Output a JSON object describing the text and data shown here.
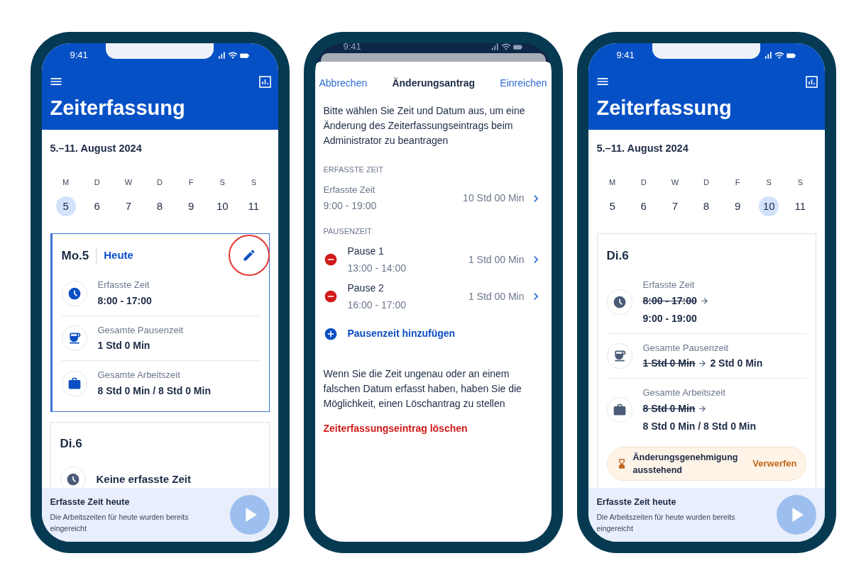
{
  "phones": [
    {
      "kind": "timesheet",
      "status_time": "9:41",
      "title": "Zeiterfassung",
      "week_range": "5.–11. August 2024",
      "weekdays": [
        {
          "letter": "M",
          "day": "5",
          "selected": true
        },
        {
          "letter": "D",
          "day": "6",
          "selected": false
        },
        {
          "letter": "W",
          "day": "7",
          "selected": false
        },
        {
          "letter": "D",
          "day": "8",
          "selected": false
        },
        {
          "letter": "F",
          "day": "9",
          "selected": false
        },
        {
          "letter": "S",
          "day": "10",
          "selected": false
        },
        {
          "letter": "S",
          "day": "11",
          "selected": false
        }
      ],
      "cards": [
        {
          "day_label": "Mo.5",
          "badge": "Heute",
          "highlighted": true,
          "editable": true,
          "edit_marked": true,
          "rows": [
            {
              "kind": "clock",
              "label": "Erfasste Zeit",
              "value": "8:00 - 17:00"
            },
            {
              "kind": "cup",
              "label": "Gesamte Pausenzeit",
              "value": "1 Std 0 Min"
            },
            {
              "kind": "briefcase",
              "label": "Gesamte Arbeitszeit",
              "value": "8 Std 0 Min / 8 Std 0 Min"
            }
          ]
        },
        {
          "day_label": "Di.6",
          "highlighted": false,
          "editable": false,
          "rows": [
            {
              "kind": "clock",
              "value": "Keine erfasste Zeit"
            }
          ]
        }
      ],
      "footer": {
        "title": "Erfasste Zeit heute",
        "text": "Die Arbeitszeiten für heute wurden bereits eingereicht",
        "play_disabled": true
      }
    },
    {
      "kind": "change_request",
      "status_time": "9:41",
      "cancel": "Abbrechen",
      "title": "Änderungsantrag",
      "submit": "Einreichen",
      "intro": "Bitte wählen Sie Zeit und Datum aus, um eine Änderung des Zeiterfassungseintrags beim Administrator zu beantragen",
      "sections": [
        {
          "heading": "ERFASSTE ZEIT",
          "items": [
            {
              "kind": "time",
              "label": "Erfasste Zeit",
              "range": "9:00 - 19:00",
              "duration": "10 Std 00 Min"
            }
          ]
        },
        {
          "heading": "PAUSENZEIT",
          "items": [
            {
              "kind": "pause",
              "label": "Pause 1",
              "range": "13:00 - 14:00",
              "duration": "1 Std 00 Min"
            },
            {
              "kind": "pause",
              "label": "Pause 2",
              "range": "16:00 - 17:00",
              "duration": "1 Std 00 Min"
            }
          ]
        }
      ],
      "add_label": "Pausenzeit hinzufügen",
      "delete_info": "Wenn Sie die Zeit ungenau oder an einem falschen Datum erfasst haben, haben Sie die Möglichkeit, einen Löschantrag zu stellen",
      "delete_label": "Zeiterfassungseintrag löschen"
    },
    {
      "kind": "timesheet",
      "status_time": "9:41",
      "title": "Zeiterfassung",
      "week_range": "5.–11. August 2024",
      "weekdays": [
        {
          "letter": "M",
          "day": "5",
          "selected": false
        },
        {
          "letter": "D",
          "day": "6",
          "selected": false
        },
        {
          "letter": "W",
          "day": "7",
          "selected": false
        },
        {
          "letter": "D",
          "day": "8",
          "selected": false
        },
        {
          "letter": "F",
          "day": "9",
          "selected": false
        },
        {
          "letter": "S",
          "day": "10",
          "selected": true
        },
        {
          "letter": "S",
          "day": "11",
          "selected": false
        }
      ],
      "cards": [
        {
          "day_label": "Di.6",
          "highlighted": false,
          "editable": false,
          "rows": [
            {
              "kind": "clock",
              "label": "Erfasste Zeit",
              "old_value": "8:00 - 17:00",
              "same_line": false,
              "value": "9:00 - 19:00"
            },
            {
              "kind": "cup",
              "label": "Gesamte Pausenzeit",
              "old_value": "1 Std 0 Min",
              "same_line": true,
              "value": "2 Std 0 Min"
            },
            {
              "kind": "briefcase",
              "label": "Gesamte Arbeitszeit",
              "old_value": "8 Std 0 Min",
              "same_line": false,
              "value": "8 Std 0 Min / 8 Std 0 Min"
            }
          ],
          "pending": {
            "text": "Änderungsgenehmigung ausstehend",
            "action": "Verwerfen"
          }
        }
      ],
      "footer": {
        "title": "Erfasste Zeit heute",
        "text": "Die Arbeitszeiten für heute wurden bereits eingereicht",
        "play_disabled": true
      }
    }
  ]
}
